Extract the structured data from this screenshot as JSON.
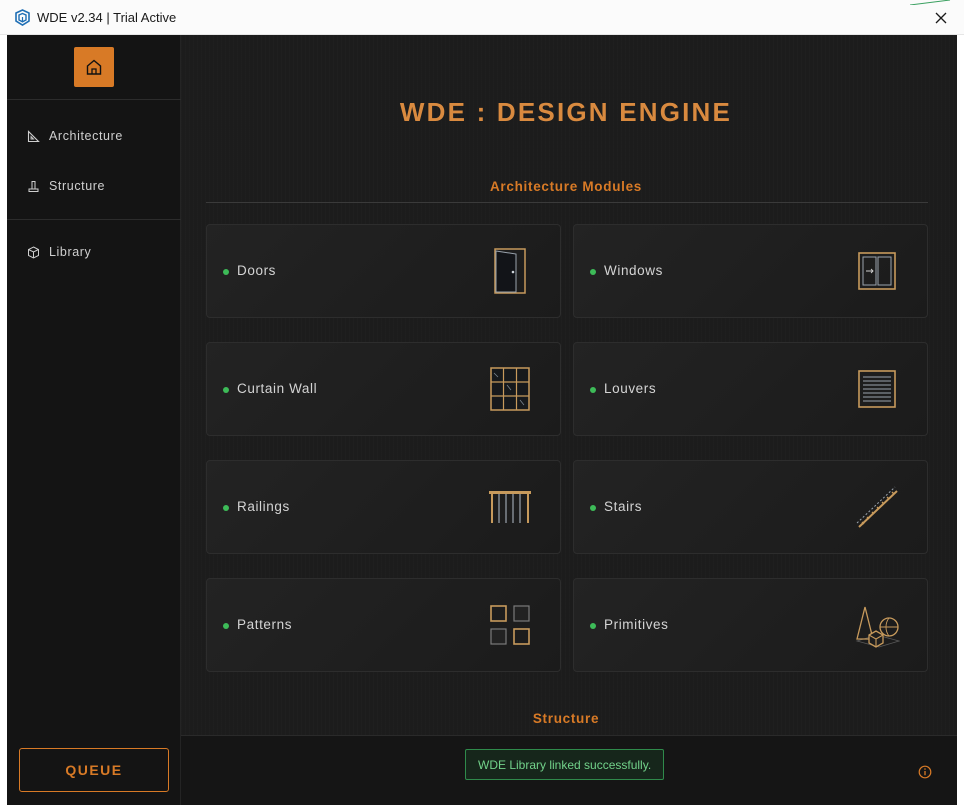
{
  "window": {
    "title": "WDE v2.34 | Trial Active"
  },
  "sidebar": {
    "home_icon": "home-icon",
    "items": [
      {
        "label": "Architecture",
        "icon": "set-square-icon"
      },
      {
        "label": "Structure",
        "icon": "column-icon"
      },
      {
        "label": "Library",
        "icon": "cube-icon"
      }
    ],
    "queue_label": "QUEUE"
  },
  "main": {
    "title": "WDE : DESIGN ENGINE",
    "sections": [
      {
        "title": "Architecture Modules",
        "modules": [
          {
            "label": "Doors",
            "icon": "door-icon"
          },
          {
            "label": "Windows",
            "icon": "window-icon"
          },
          {
            "label": "Curtain Wall",
            "icon": "curtain-wall-icon"
          },
          {
            "label": "Louvers",
            "icon": "louvers-icon"
          },
          {
            "label": "Railings",
            "icon": "railings-icon"
          },
          {
            "label": "Stairs",
            "icon": "stairs-icon"
          },
          {
            "label": "Patterns",
            "icon": "patterns-icon"
          },
          {
            "label": "Primitives",
            "icon": "primitives-icon"
          }
        ]
      },
      {
        "title": "Structure"
      }
    ]
  },
  "footer": {
    "status_message": "WDE Library linked successfully.",
    "info_icon": "info-icon"
  },
  "colors": {
    "accent": "#d87a26",
    "background": "#1b1b1b",
    "sidebar": "#141414",
    "status_green": "#3dbb58",
    "success_text": "#72d28a"
  }
}
